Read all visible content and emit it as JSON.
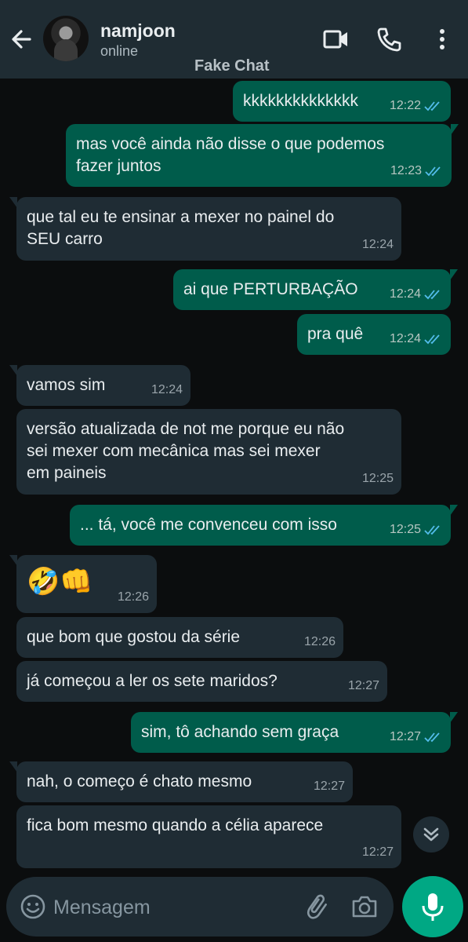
{
  "contact": {
    "name": "namjoon",
    "status": "online"
  },
  "watermark": "Fake Chat",
  "colors": {
    "header_bg": "#1f2c33",
    "outgoing_bubble": "#005c4b",
    "incoming_bubble": "#1f2c34",
    "read_ticks": "#53bdeb",
    "accent": "#00a884"
  },
  "icons": {
    "back": "arrow-left-icon",
    "video": "video-camera-icon",
    "call": "phone-icon",
    "menu": "kebab-menu-icon",
    "emoji": "emoji-icon",
    "attach": "paperclip-icon",
    "camera": "camera-icon",
    "mic": "microphone-icon",
    "scroll": "double-chevron-down-icon"
  },
  "messages": [
    {
      "dir": "out",
      "lines": [
        "kkkkkkkkkkkkkk"
      ],
      "time": "12:22",
      "read": true
    },
    {
      "dir": "out",
      "lines": [
        "mas você ainda não disse o que podemos",
        "fazer juntos"
      ],
      "time": "12:23",
      "read": true
    },
    {
      "dir": "in",
      "lines": [
        "que tal eu te ensinar a mexer no painel do",
        "SEU carro"
      ],
      "time": "12:24"
    },
    {
      "dir": "out",
      "lines": [
        "ai que PERTURBAÇÃO"
      ],
      "time": "12:24",
      "read": true
    },
    {
      "dir": "out",
      "lines": [
        "pra quê"
      ],
      "time": "12:24",
      "read": true
    },
    {
      "dir": "in",
      "lines": [
        "vamos sim"
      ],
      "time": "12:24"
    },
    {
      "dir": "in",
      "lines": [
        "versão atualizada de not me porque eu não",
        "sei mexer com mecânica mas sei mexer",
        "em paineis"
      ],
      "time": "12:25"
    },
    {
      "dir": "out",
      "lines": [
        "... tá, você me convenceu com isso"
      ],
      "time": "12:25",
      "read": true
    },
    {
      "dir": "in",
      "lines": [
        "🤣👊"
      ],
      "time": "12:26"
    },
    {
      "dir": "in",
      "lines": [
        "que bom que gostou da série"
      ],
      "time": "12:26"
    },
    {
      "dir": "in",
      "lines": [
        "já começou a ler os sete maridos?"
      ],
      "time": "12:27"
    },
    {
      "dir": "out",
      "lines": [
        "sim, tô achando sem graça"
      ],
      "time": "12:27",
      "read": true
    },
    {
      "dir": "in",
      "lines": [
        "nah, o começo é chato mesmo"
      ],
      "time": "12:27"
    },
    {
      "dir": "in",
      "lines": [
        "fica bom mesmo quando a célia aparece"
      ],
      "time": "12:27"
    }
  ],
  "composer": {
    "placeholder": "Mensagem"
  }
}
